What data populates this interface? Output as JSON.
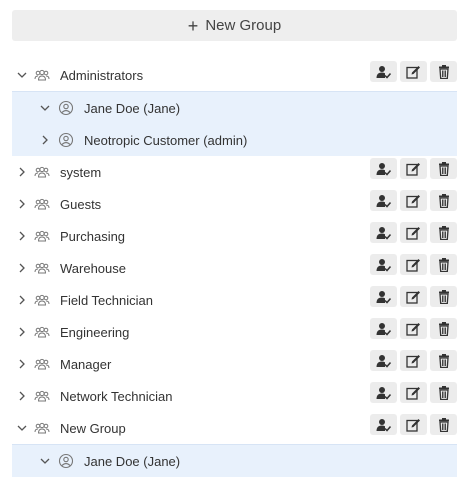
{
  "toolbar": {
    "new_group_label": "New Group"
  },
  "colors": {
    "child_highlight": "#e8f1fc",
    "button_bg": "#ececec",
    "icon": "#333333"
  },
  "icons": {
    "group": "group-icon",
    "user": "user-circle-icon",
    "assign": "assign-user-icon",
    "edit": "edit-icon",
    "delete": "trash-icon",
    "expand": "chevron-right-icon",
    "collapse": "chevron-down-icon"
  },
  "tree": [
    {
      "label": "Administrators",
      "expanded": true,
      "children": [
        {
          "label": "Jane Doe (Jane)",
          "expanded": true
        },
        {
          "label": "Neotropic Customer (admin)",
          "expanded": false
        }
      ]
    },
    {
      "label": "system",
      "expanded": false,
      "children": []
    },
    {
      "label": "Guests",
      "expanded": false,
      "children": []
    },
    {
      "label": "Purchasing",
      "expanded": false,
      "children": []
    },
    {
      "label": "Warehouse",
      "expanded": false,
      "children": []
    },
    {
      "label": "Field Technician",
      "expanded": false,
      "children": []
    },
    {
      "label": "Engineering",
      "expanded": false,
      "children": []
    },
    {
      "label": "Manager",
      "expanded": false,
      "children": []
    },
    {
      "label": "Network Technician",
      "expanded": false,
      "children": []
    },
    {
      "label": "New Group",
      "expanded": true,
      "children": [
        {
          "label": "Jane Doe (Jane)",
          "expanded": true
        }
      ]
    }
  ]
}
